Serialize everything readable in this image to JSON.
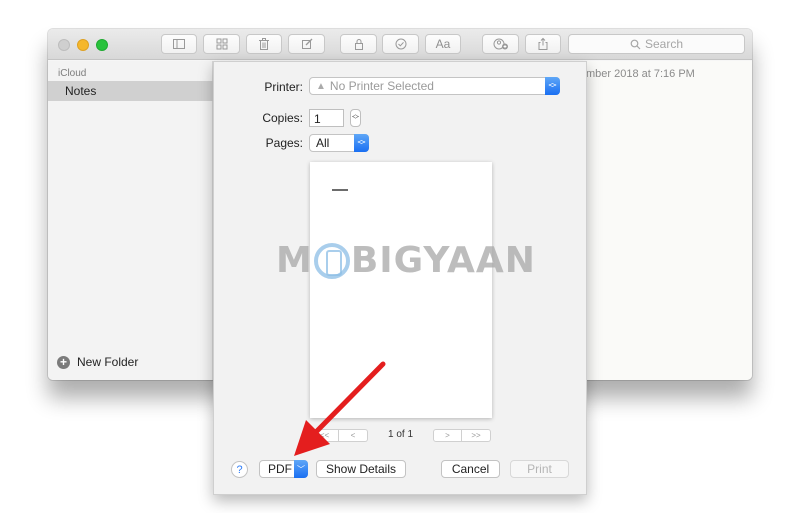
{
  "window": {
    "toolbar": {
      "buttons": [
        {
          "name": "sidebar-toggle",
          "icon": "sidebar-icon"
        },
        {
          "name": "attachments-browser",
          "icon": "grid-icon"
        },
        {
          "name": "delete",
          "icon": "trash-icon"
        },
        {
          "name": "new-note",
          "icon": "compose-icon"
        },
        {
          "name": "lock",
          "icon": "lock-icon"
        },
        {
          "name": "checklist",
          "icon": "checkmark-circle-icon"
        },
        {
          "name": "format",
          "icon": "text-format-icon",
          "label": "Aa"
        },
        {
          "name": "add-people",
          "icon": "add-people-icon"
        },
        {
          "name": "share",
          "icon": "share-icon"
        }
      ],
      "search_placeholder": "Search"
    },
    "sidebar": {
      "group_label": "iCloud",
      "selected_folder": "Notes",
      "new_folder_label": "New Folder"
    },
    "note": {
      "date_text": "mber 2018 at 7:16 PM"
    }
  },
  "print_dialog": {
    "printer_label": "Printer:",
    "printer_value": "No Printer Selected",
    "copies_label": "Copies:",
    "copies_value": "1",
    "pages_label": "Pages:",
    "pages_value": "All",
    "page_counter": "1 of 1",
    "pager": {
      "first": "<<",
      "prev": "<",
      "next": ">",
      "last": ">>"
    },
    "help_label": "?",
    "pdf_label": "PDF",
    "show_details_label": "Show Details",
    "cancel_label": "Cancel",
    "print_label": "Print"
  },
  "watermark": {
    "text_before": "M",
    "text_after": "BIGYAAN"
  },
  "colors": {
    "accent_blue": "#1a6ff2",
    "annotation_arrow": "#e41e1e"
  }
}
